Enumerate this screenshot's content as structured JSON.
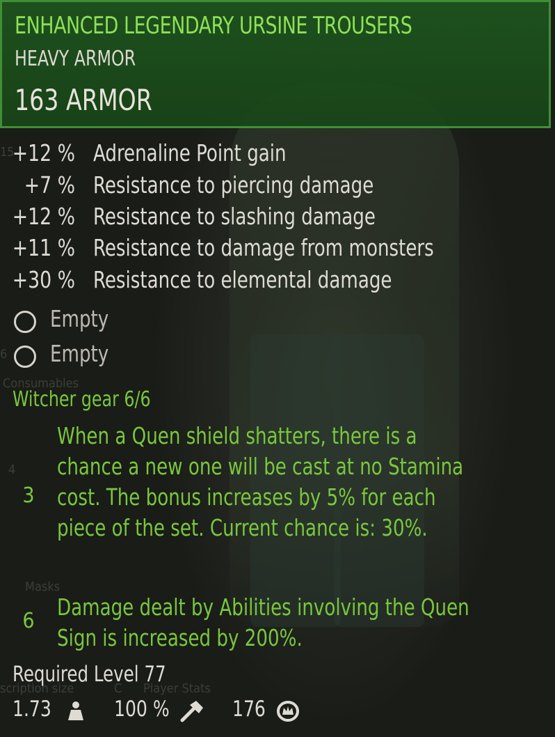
{
  "background_text": {
    "n1": "15",
    "n2": "4",
    "n3": "6",
    "consumables": "Consumables",
    "masks": "Masks",
    "inscription": "scription size",
    "c": "C",
    "player_stats": "Player Stats"
  },
  "tooltip": {
    "name": "ENHANCED LEGENDARY URSINE TROUSERS",
    "type": "HEAVY ARMOR",
    "armor": "163 ARMOR",
    "stats": [
      {
        "value": "+12 %",
        "label": "Adrenaline Point gain"
      },
      {
        "value": "+7 %",
        "label": "Resistance to piercing damage"
      },
      {
        "value": "+12 %",
        "label": "Resistance to slashing damage"
      },
      {
        "value": "+11 %",
        "label": "Resistance to damage from monsters"
      },
      {
        "value": "+30 %",
        "label": "Resistance to elemental damage"
      }
    ],
    "slots": [
      {
        "label": "Empty"
      },
      {
        "label": "Empty"
      }
    ],
    "set_title": "Witcher gear 6/6",
    "set_bonuses": [
      {
        "pieces": "3",
        "text": "When a Quen shield shatters, there is a chance a new one will be cast at no Stamina cost. The bonus increases by 5% for each piece of the set. Current chance is: 30%."
      },
      {
        "pieces": "6",
        "text": "Damage dealt by Abilities involving the Quen Sign is increased by 200%."
      }
    ],
    "required_level": "Required Level 77",
    "footer": {
      "weight": "1.73",
      "durability": "100 %",
      "price": "176"
    }
  },
  "colors": {
    "header_bg": "#1e551e",
    "header_border": "#3f8f35",
    "item_name": "#8fe057",
    "set_green": "#79c73d",
    "text": "#dedbd3"
  },
  "icons": [
    "weight-icon",
    "hammer-icon",
    "crowns-icon"
  ]
}
